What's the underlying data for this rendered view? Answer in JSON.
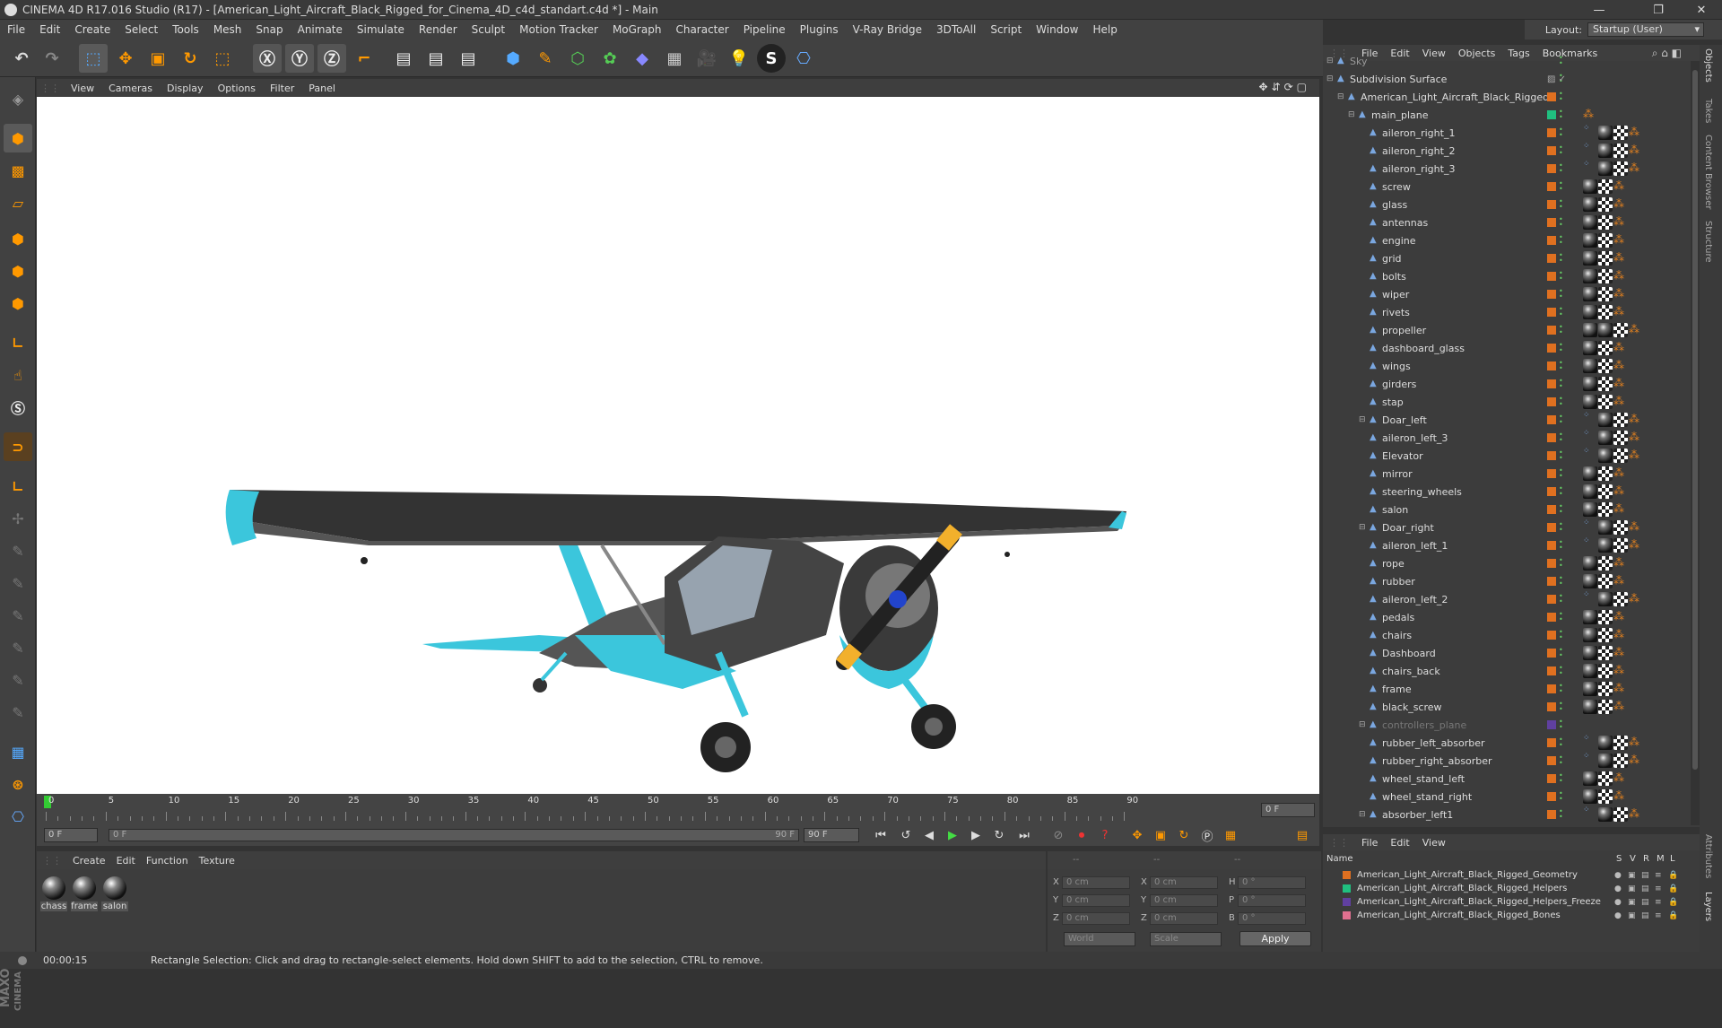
{
  "window": {
    "title": "CINEMA 4D R17.016 Studio (R17) - [American_Light_Aircraft_Black_Rigged_for_Cinema_4D_c4d_standart.c4d *] - Main",
    "minimize": "—",
    "restore": "❐",
    "close": "✕"
  },
  "menu": [
    "File",
    "Edit",
    "Create",
    "Select",
    "Tools",
    "Mesh",
    "Snap",
    "Animate",
    "Simulate",
    "Render",
    "Sculpt",
    "Motion Tracker",
    "MoGraph",
    "Character",
    "Pipeline",
    "Plugins",
    "V-Ray Bridge",
    "3DToAll",
    "Script",
    "Window",
    "Help"
  ],
  "layout": {
    "label": "Layout:",
    "value": "Startup (User)"
  },
  "viewport_menu": [
    "View",
    "Cameras",
    "Display",
    "Options",
    "Filter",
    "Panel"
  ],
  "timeline": {
    "ticks": [
      "0",
      "5",
      "10",
      "15",
      "20",
      "25",
      "30",
      "35",
      "40",
      "45",
      "50",
      "55",
      "60",
      "65",
      "70",
      "75",
      "80",
      "85",
      "90"
    ],
    "current_frame": "0 F",
    "start": "0 F",
    "range_start": "0 F",
    "range_end": "90 F",
    "end": "90 F"
  },
  "material_menu": [
    "Create",
    "Edit",
    "Function",
    "Texture"
  ],
  "materials": [
    {
      "name": "chass"
    },
    {
      "name": "frame"
    },
    {
      "name": "salon"
    }
  ],
  "coords": {
    "headers": [
      "--",
      "--",
      "--"
    ],
    "rows": [
      {
        "l1": "X",
        "v1": "0 cm",
        "l2": "X",
        "v2": "0 cm",
        "l3": "H",
        "v3": "0 °"
      },
      {
        "l1": "Y",
        "v1": "0 cm",
        "l2": "Y",
        "v2": "0 cm",
        "l3": "P",
        "v3": "0 °"
      },
      {
        "l1": "Z",
        "v1": "0 cm",
        "l2": "Z",
        "v2": "0 cm",
        "l3": "B",
        "v3": "0 °"
      }
    ],
    "world": "World",
    "scale": "Scale",
    "apply": "Apply"
  },
  "status": {
    "time": "00:00:15",
    "message": "Rectangle Selection: Click and drag to rectangle-select elements. Hold down SHIFT to add to the selection, CTRL to remove."
  },
  "object_menu": [
    "File",
    "Edit",
    "View",
    "Objects",
    "Tags",
    "Bookmarks"
  ],
  "objects": [
    {
      "name": "Sky",
      "indent": 0
    },
    {
      "name": "Subdivision Surface",
      "indent": 0
    },
    {
      "name": "American_Light_Aircraft_Black_Rigged",
      "indent": 1
    },
    {
      "name": "main_plane",
      "indent": 2
    },
    {
      "name": "aileron_right_1",
      "indent": 3
    },
    {
      "name": "aileron_right_2",
      "indent": 3
    },
    {
      "name": "aileron_right_3",
      "indent": 3
    },
    {
      "name": "screw",
      "indent": 3
    },
    {
      "name": "glass",
      "indent": 3
    },
    {
      "name": "antennas",
      "indent": 3
    },
    {
      "name": "engine",
      "indent": 3
    },
    {
      "name": "grid",
      "indent": 3
    },
    {
      "name": "bolts",
      "indent": 3
    },
    {
      "name": "wiper",
      "indent": 3
    },
    {
      "name": "rivets",
      "indent": 3
    },
    {
      "name": "propeller",
      "indent": 3
    },
    {
      "name": "dashboard_glass",
      "indent": 3
    },
    {
      "name": "wings",
      "indent": 3
    },
    {
      "name": "girders",
      "indent": 3
    },
    {
      "name": "stap",
      "indent": 3
    },
    {
      "name": "Doar_left",
      "indent": 3
    },
    {
      "name": "aileron_left_3",
      "indent": 3
    },
    {
      "name": "Elevator",
      "indent": 3
    },
    {
      "name": "mirror",
      "indent": 3
    },
    {
      "name": "steering_wheels",
      "indent": 3
    },
    {
      "name": "salon",
      "indent": 3
    },
    {
      "name": "Doar_right",
      "indent": 3
    },
    {
      "name": "aileron_left_1",
      "indent": 3
    },
    {
      "name": "rope",
      "indent": 3
    },
    {
      "name": "rubber",
      "indent": 3
    },
    {
      "name": "aileron_left_2",
      "indent": 3
    },
    {
      "name": "pedals",
      "indent": 3
    },
    {
      "name": "chairs",
      "indent": 3
    },
    {
      "name": "Dashboard",
      "indent": 3
    },
    {
      "name": "chairs_back",
      "indent": 3
    },
    {
      "name": "frame",
      "indent": 3
    },
    {
      "name": "black_screw",
      "indent": 3
    },
    {
      "name": "controllers_plane",
      "indent": 3
    },
    {
      "name": "rubber_left_absorber",
      "indent": 3
    },
    {
      "name": "rubber_right_absorber",
      "indent": 3
    },
    {
      "name": "wheel_stand_left",
      "indent": 3
    },
    {
      "name": "wheel_stand_right",
      "indent": 3
    },
    {
      "name": "absorber_left1",
      "indent": 3
    }
  ],
  "layer_menu": [
    "File",
    "Edit",
    "View"
  ],
  "layer_header": {
    "name": "Name",
    "cols": [
      "S",
      "V",
      "R",
      "M",
      "L"
    ]
  },
  "layers": [
    {
      "name": "American_Light_Aircraft_Black_Rigged_Geometry",
      "color": "#e07020"
    },
    {
      "name": "American_Light_Aircraft_Black_Rigged_Helpers",
      "color": "#20c080"
    },
    {
      "name": "American_Light_Aircraft_Black_Rigged_Helpers_Freeze",
      "color": "#6040a0"
    },
    {
      "name": "American_Light_Aircraft_Black_Rigged_Bones",
      "color": "#e07090"
    }
  ],
  "side_tabs": [
    "Objects",
    "Takes",
    "Content Browser",
    "Structure",
    "Attributes",
    "Layers"
  ]
}
